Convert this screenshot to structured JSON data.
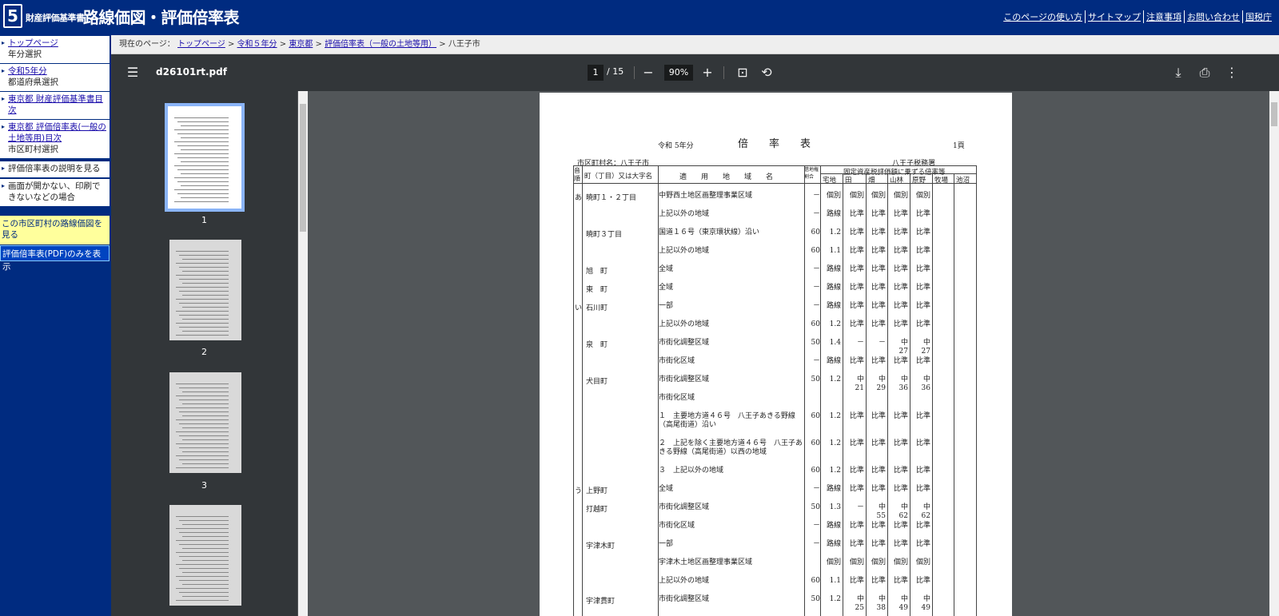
{
  "header": {
    "logo_num": "5",
    "brand_small": "財産評価基準書",
    "brand_big": "路線価図・評価倍率表",
    "links": [
      "このページの使い方",
      "サイトマップ",
      "注意事項",
      "お問い合わせ",
      "国税庁"
    ]
  },
  "sidebar": {
    "items": [
      {
        "link": "トップページ",
        "sub": "年分選択"
      },
      {
        "link": "令和5年分",
        "sub": "都道府県選択"
      },
      {
        "link": "東京都 財産評価基準書目次",
        "sub": ""
      },
      {
        "link": "東京都 評価倍率表(一般の土地等用)目次",
        "sub": "市区町村選択"
      },
      {
        "text": "評価倍率表の説明を見る"
      },
      {
        "text": "画面が開かない、印刷できないなどの場合"
      }
    ],
    "yellow": "この市区町村の路線価図を見る",
    "blue": "評価倍率表(PDF)のみを表示"
  },
  "breadcrumb": {
    "prefix": "現在のページ：",
    "items": [
      "トップページ",
      "令和５年分",
      "東京都",
      "評価倍率表（一般の土地等用）"
    ],
    "current": "八王子市"
  },
  "viewer": {
    "filename": "d26101rt.pdf",
    "page": "1",
    "total": "/ 15",
    "zoom": "90%",
    "thumb_nums": [
      "1",
      "2",
      "3"
    ]
  },
  "doc": {
    "era": "令和 5年分",
    "title": "倍　　率　　表",
    "pagenum": "1頁",
    "city_label": "市区町村名：八王子市",
    "office": "八王子税務署",
    "col_on": "音順",
    "col_town": "町（丁目）又は大字名",
    "col_area": "適　　用　　地　　域　　名",
    "col_rate": "借地権割合",
    "col_group": "固定資産税評価額に乗ずる倍率等",
    "cols": [
      "宅地",
      "田",
      "畑",
      "山林",
      "原野",
      "牧場",
      "池沼"
    ],
    "rows": [
      {
        "on": "あ",
        "town": "暁町１・２丁目",
        "area": "中野西土地区画整理事業区域",
        "rate": "－",
        "v": [
          "個別",
          "個別",
          "個別",
          "個別",
          "個別"
        ]
      },
      {
        "on": "",
        "town": "",
        "area": "上記以外の地域",
        "rate": "－",
        "v": [
          "路線",
          "比準",
          "比準",
          "比準",
          "比準"
        ]
      },
      {
        "on": "",
        "town": "暁町３丁目",
        "area": "国道１６号（東京環状線）沿い",
        "rate": "60",
        "v": [
          "1.2",
          "比準",
          "比準",
          "比準",
          "比準"
        ]
      },
      {
        "on": "",
        "town": "",
        "area": "上記以外の地域",
        "rate": "60",
        "v": [
          "1.1",
          "比準",
          "比準",
          "比準",
          "比準"
        ]
      },
      {
        "on": "",
        "town": "旭　町",
        "area": "全域",
        "rate": "－",
        "v": [
          "路線",
          "比準",
          "比準",
          "比準",
          "比準"
        ]
      },
      {
        "on": "",
        "town": "東　町",
        "area": "全域",
        "rate": "－",
        "v": [
          "路線",
          "比準",
          "比準",
          "比準",
          "比準"
        ]
      },
      {
        "on": "い",
        "town": "石川町",
        "area": "一部",
        "rate": "－",
        "v": [
          "路線",
          "比準",
          "比準",
          "比準",
          "比準"
        ]
      },
      {
        "on": "",
        "town": "",
        "area": "上記以外の地域",
        "rate": "60",
        "v": [
          "1.2",
          "比準",
          "比準",
          "比準",
          "比準"
        ]
      },
      {
        "on": "",
        "town": "泉　町",
        "area": "市街化調整区域",
        "rate": "50",
        "v": [
          "1.4",
          "－",
          "－",
          "中　27",
          "中　27"
        ]
      },
      {
        "on": "",
        "town": "",
        "area": "市街化区域",
        "rate": "－",
        "v": [
          "路線",
          "比準",
          "比準",
          "比準",
          "比準"
        ]
      },
      {
        "on": "",
        "town": "犬目町",
        "area": "市街化調整区域",
        "rate": "50",
        "v": [
          "1.2",
          "中　21",
          "中　29",
          "中　36",
          "中　36"
        ]
      },
      {
        "on": "",
        "town": "",
        "area": "市街化区域",
        "rate": "",
        "v": [
          "",
          "",
          "",
          "",
          ""
        ]
      },
      {
        "on": "",
        "town": "",
        "area": "１　主要地方道４６号　八王子あきる野線（高尾街道）沿い",
        "rate": "60",
        "v": [
          "1.2",
          "比準",
          "比準",
          "比準",
          "比準"
        ]
      },
      {
        "on": "",
        "town": "",
        "area": "２　上記を除く主要地方道４６号　八王子あきる野線（高尾街道）以西の地域",
        "rate": "60",
        "v": [
          "1.2",
          "比準",
          "比準",
          "比準",
          "比準"
        ]
      },
      {
        "on": "",
        "town": "",
        "area": "３　上記以外の地域",
        "rate": "60",
        "v": [
          "1.2",
          "比準",
          "比準",
          "比準",
          "比準"
        ]
      },
      {
        "on": "う",
        "town": "上野町",
        "area": "全域",
        "rate": "－",
        "v": [
          "路線",
          "比準",
          "比準",
          "比準",
          "比準"
        ]
      },
      {
        "on": "",
        "town": "打越町",
        "area": "市街化調整区域",
        "rate": "50",
        "v": [
          "1.3",
          "－",
          "中　55",
          "中　62",
          "中　62"
        ]
      },
      {
        "on": "",
        "town": "",
        "area": "市街化区域",
        "rate": "－",
        "v": [
          "路線",
          "比準",
          "比準",
          "比準",
          "比準"
        ]
      },
      {
        "on": "",
        "town": "宇津木町",
        "area": "一部",
        "rate": "－",
        "v": [
          "路線",
          "比準",
          "比準",
          "比準",
          "比準"
        ]
      },
      {
        "on": "",
        "town": "",
        "area": "宇津木土地区画整理事業区域",
        "rate": "",
        "v": [
          "個別",
          "個別",
          "個別",
          "個別",
          "個別"
        ]
      },
      {
        "on": "",
        "town": "",
        "area": "上記以外の地域",
        "rate": "60",
        "v": [
          "1.1",
          "比準",
          "比準",
          "比準",
          "比準"
        ]
      },
      {
        "on": "",
        "town": "宇津貫町",
        "area": "市街化調整区域",
        "rate": "50",
        "v": [
          "1.2",
          "中　25",
          "中　38",
          "中　49",
          "中　49"
        ]
      }
    ]
  }
}
